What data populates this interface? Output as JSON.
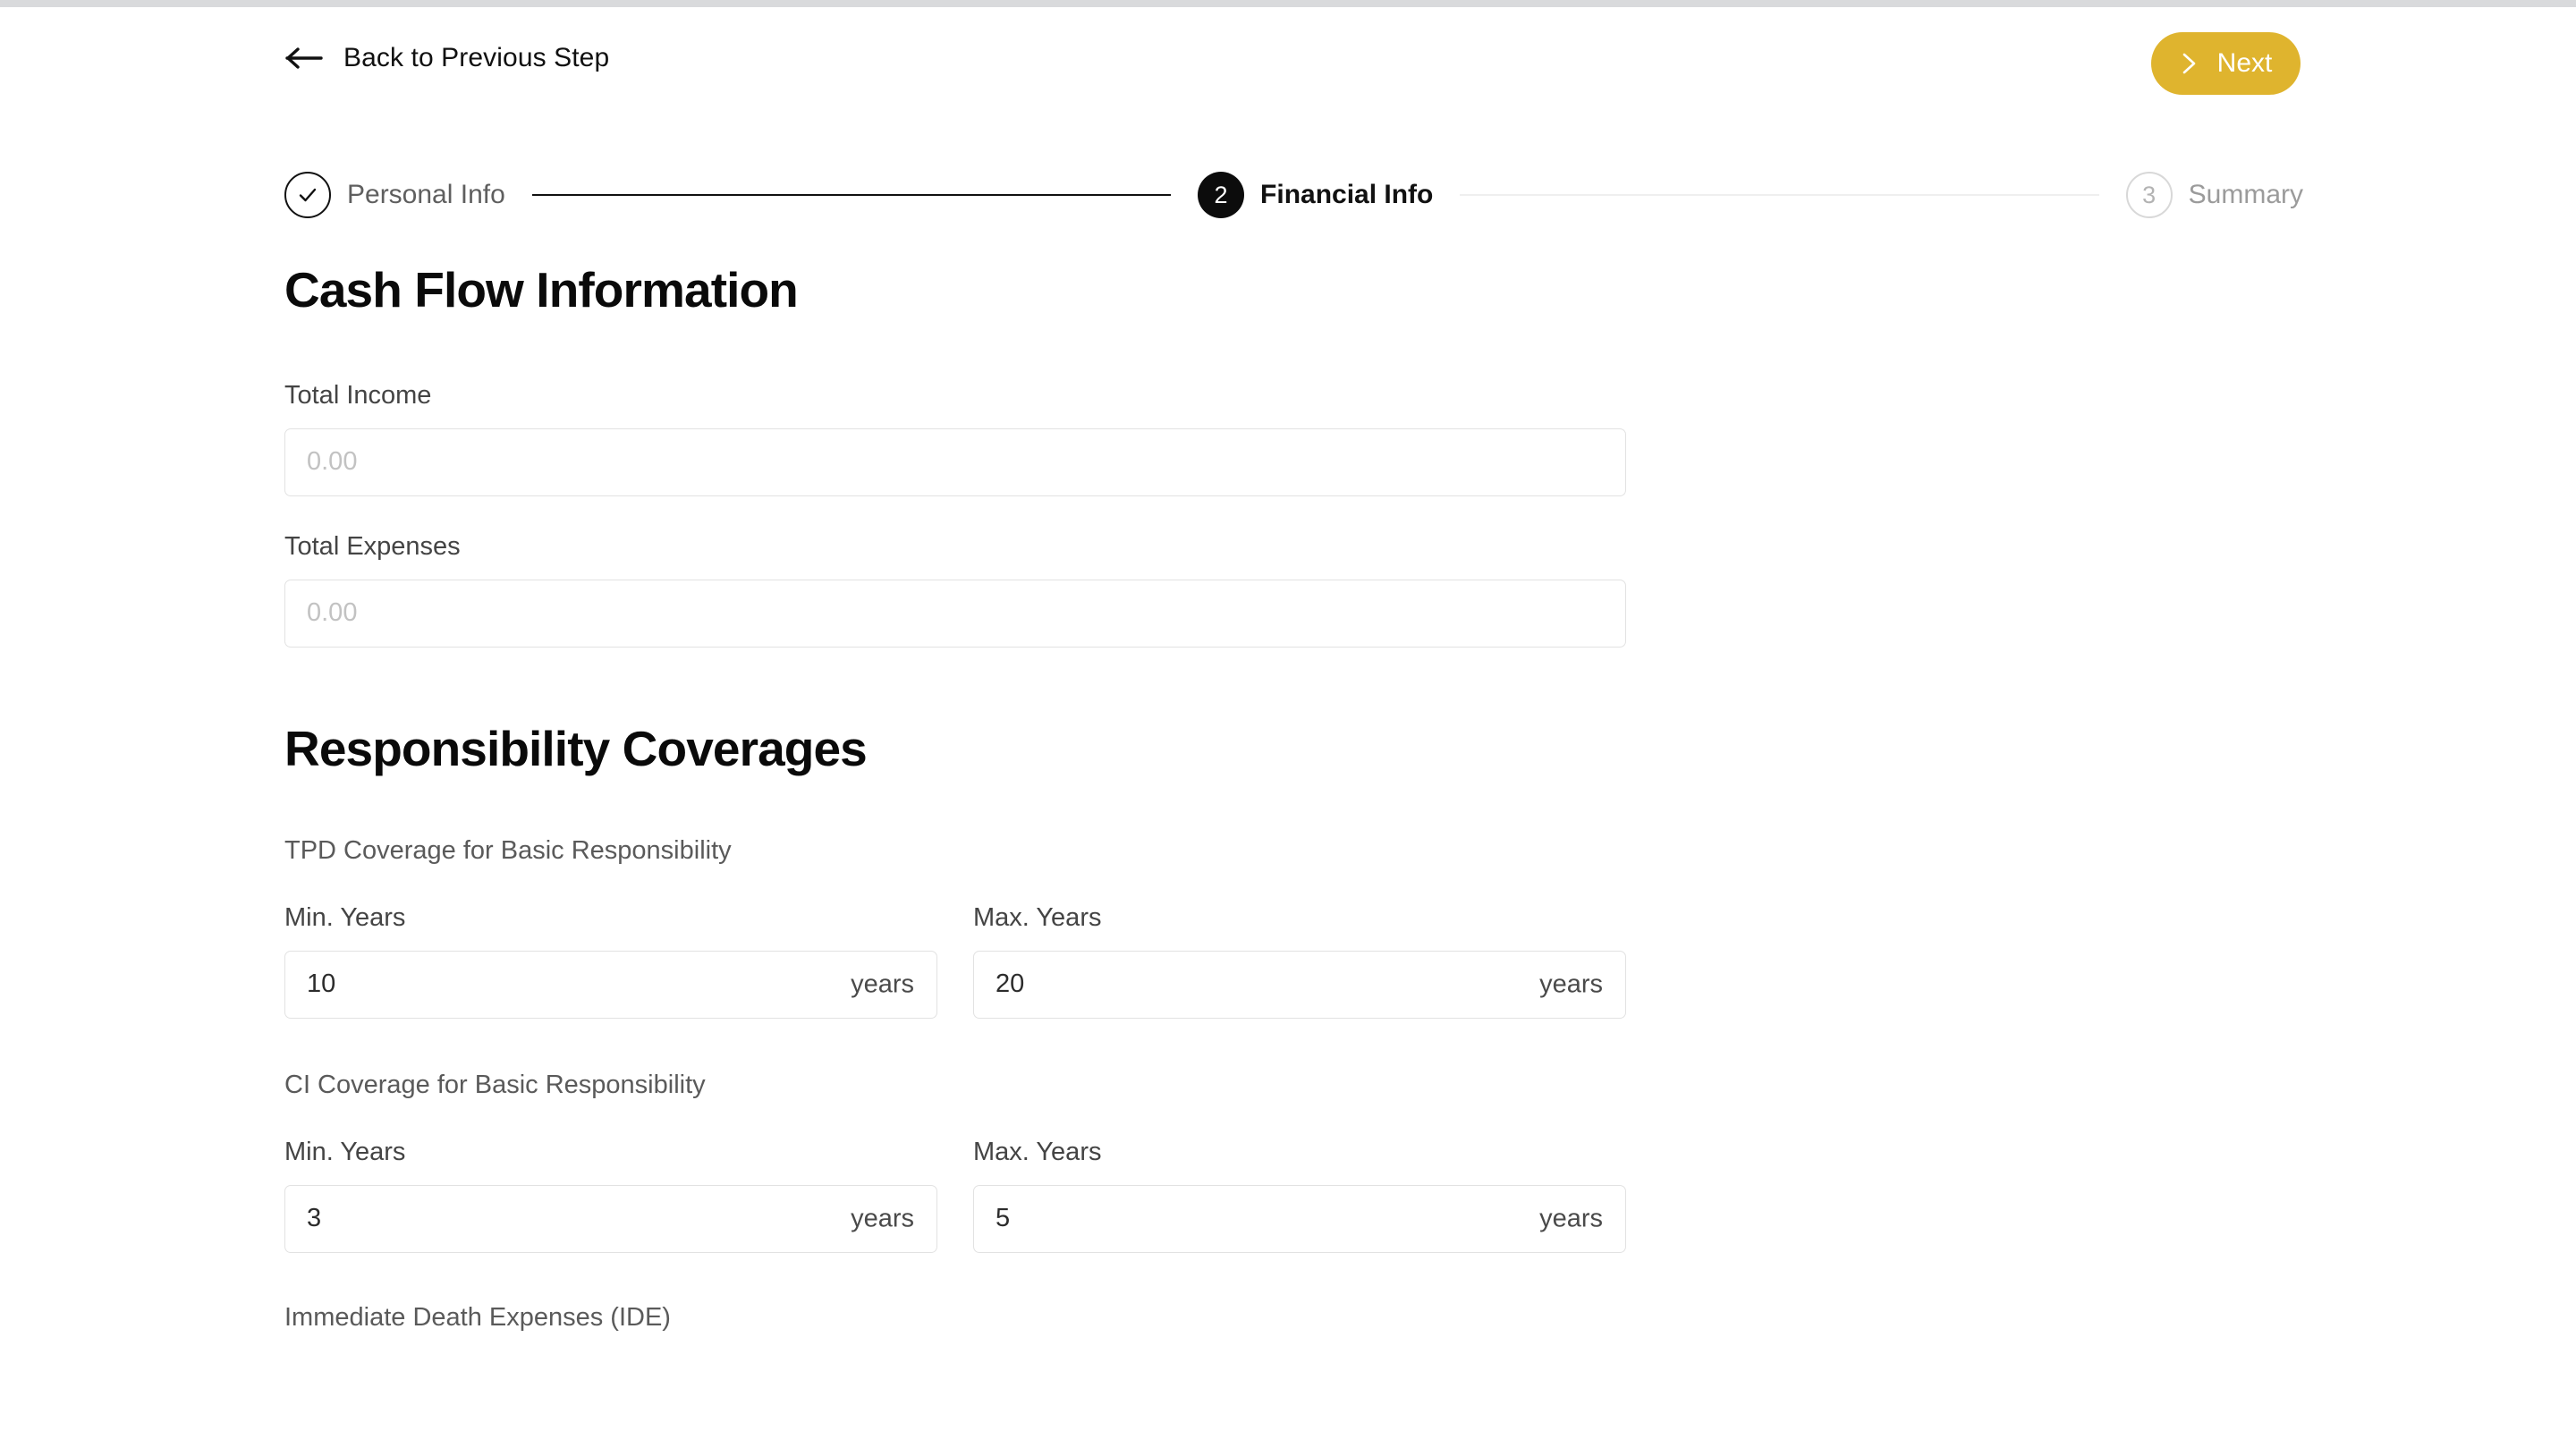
{
  "topbar": {
    "back_label": "Back to Previous Step",
    "next_label": "Next",
    "next_bg_color": "#dfb42e"
  },
  "stepper": {
    "steps": [
      {
        "indicator": "✓",
        "label": "Personal Info",
        "state": "done"
      },
      {
        "indicator": "2",
        "label": "Financial Info",
        "state": "active"
      },
      {
        "indicator": "3",
        "label": "Summary",
        "state": "todo"
      }
    ]
  },
  "cash_flow": {
    "heading": "Cash Flow Information",
    "fields": [
      {
        "label": "Total Income",
        "value": "",
        "placeholder": "0.00"
      },
      {
        "label": "Total Expenses",
        "value": "",
        "placeholder": "0.00"
      }
    ]
  },
  "responsibility": {
    "heading": "Responsibility Coverages",
    "min_label": "Min. Years",
    "max_label": "Max. Years",
    "suffix": "years",
    "groups": [
      {
        "title": "TPD Coverage for Basic Responsibility",
        "min_value": "10",
        "max_value": "20"
      },
      {
        "title": "CI Coverage for Basic Responsibility",
        "min_value": "3",
        "max_value": "5"
      }
    ],
    "next_group_title": "Immediate Death Expenses (IDE)"
  }
}
